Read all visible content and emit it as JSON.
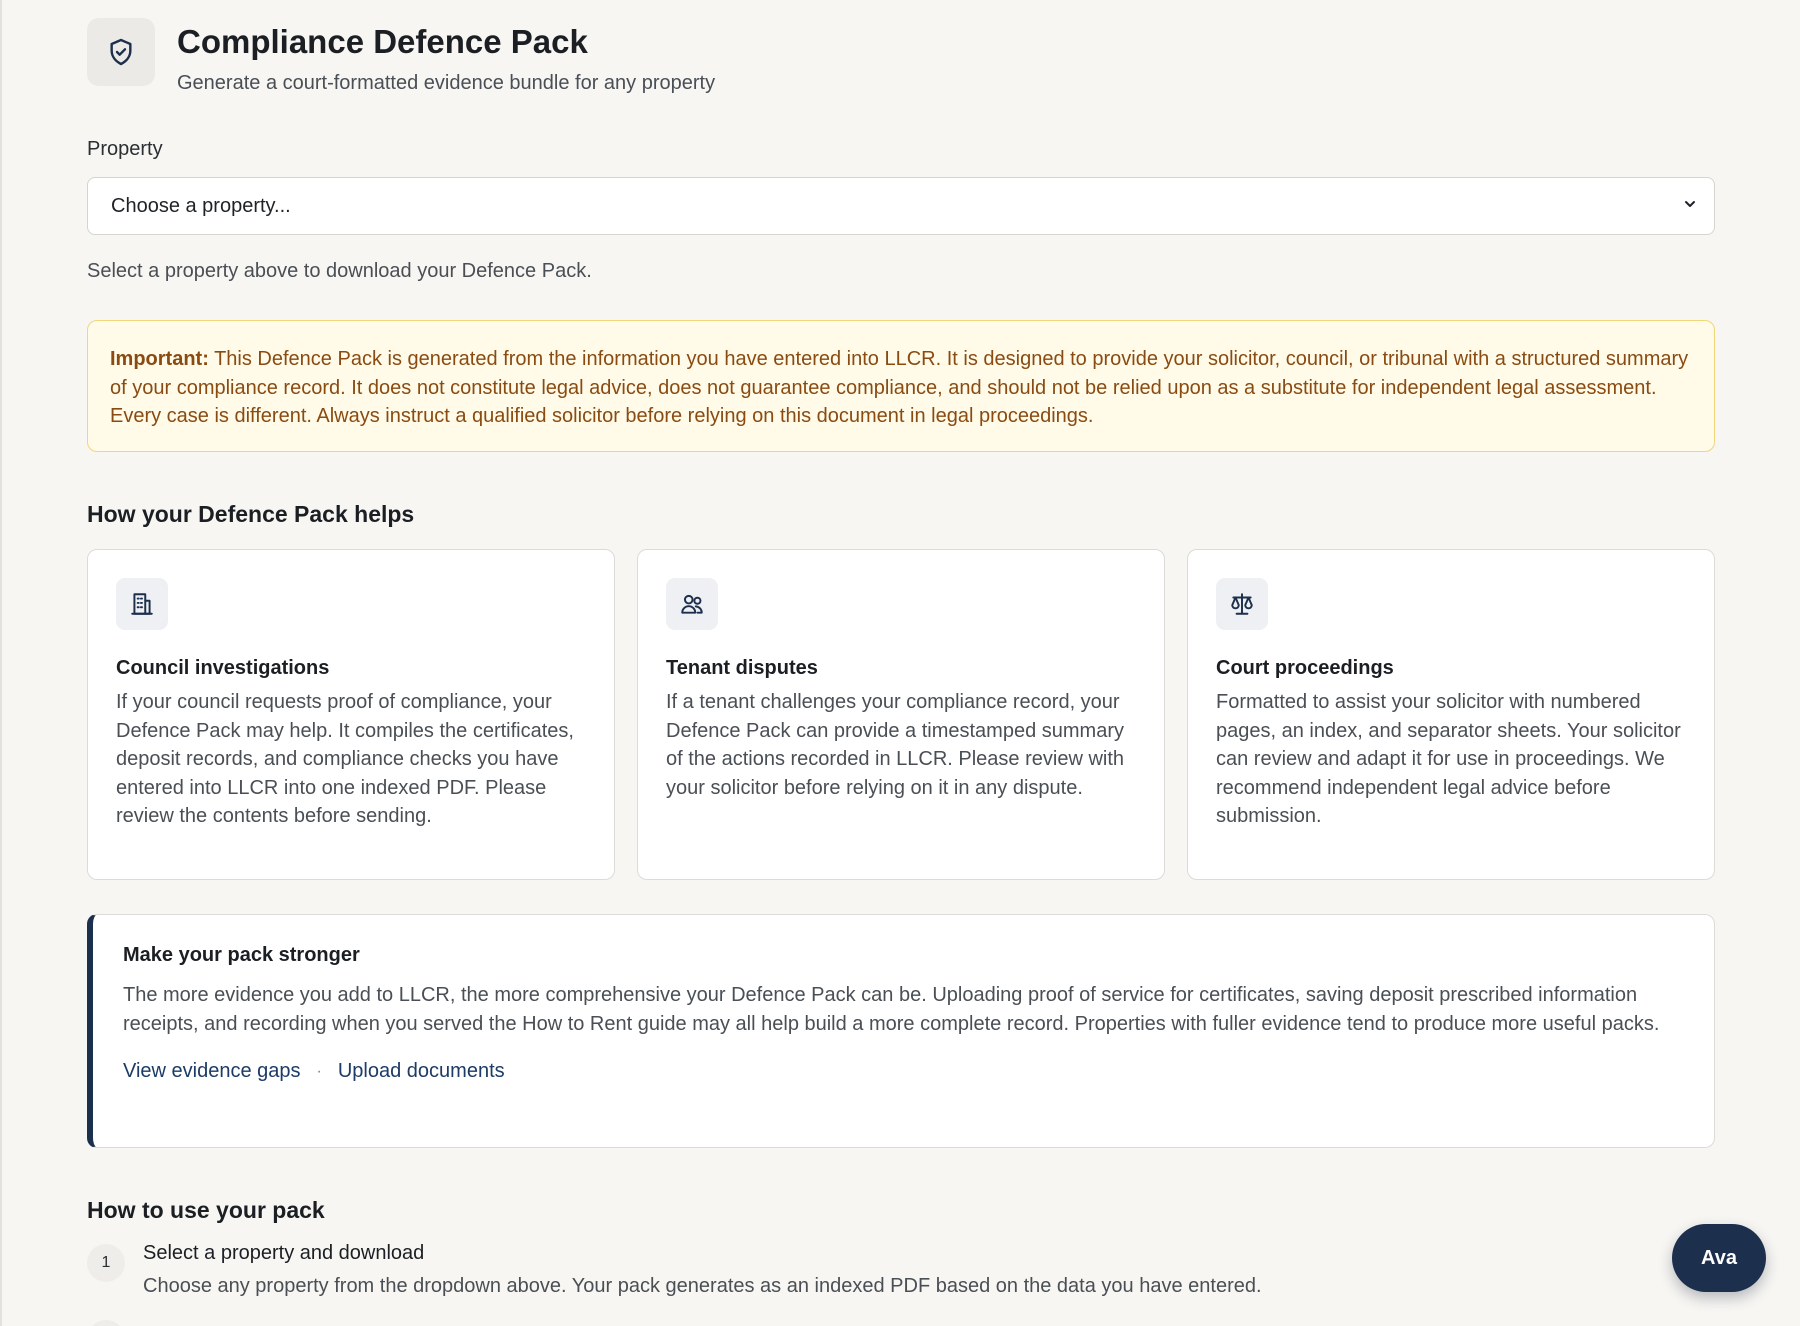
{
  "header": {
    "icon": "shield-check-icon",
    "title": "Compliance Defence Pack",
    "subtitle": "Generate a court-formatted evidence bundle for any property"
  },
  "property": {
    "label": "Property",
    "selected": "Choose a property...",
    "hint": "Select a property above to download your Defence Pack."
  },
  "alert": {
    "strong": "Important:",
    "text": "This Defence Pack is generated from the information you have entered into LLCR. It is designed to provide your solicitor, council, or tribunal with a structured summary of your compliance record. It does not constitute legal advice, does not guarantee compliance, and should not be relied upon as a substitute for independent legal assessment. Every case is different. Always instruct a qualified solicitor before relying on this document in legal proceedings."
  },
  "helps": {
    "title": "How your Defence Pack helps",
    "cards": [
      {
        "icon": "building-icon",
        "title": "Council investigations",
        "body": "If your council requests proof of compliance, your Defence Pack may help. It compiles the certificates, deposit records, and compliance checks you have entered into LLCR into one indexed PDF. Please review the contents before sending."
      },
      {
        "icon": "users-icon",
        "title": "Tenant disputes",
        "body": "If a tenant challenges your compliance record, your Defence Pack can provide a timestamped summary of the actions recorded in LLCR. Please review with your solicitor before relying on it in any dispute."
      },
      {
        "icon": "scales-icon",
        "title": "Court proceedings",
        "body": "Formatted to assist your solicitor with numbered pages, an index, and separator sheets. Your solicitor can review and adapt it for use in proceedings. We recommend independent legal advice before submission."
      }
    ]
  },
  "stronger": {
    "title": "Make your pack stronger",
    "body": "The more evidence you add to LLCR, the more comprehensive your Defence Pack can be. Uploading proof of service for certificates, saving deposit prescribed information receipts, and recording when you served the How to Rent guide may all help build a more complete record. Properties with fuller evidence tend to produce more useful packs.",
    "link_gaps": "View evidence gaps",
    "separator": "·",
    "link_upload": "Upload documents"
  },
  "usage": {
    "title": "How to use your pack",
    "steps": [
      {
        "num": "1",
        "title": "Select a property and download",
        "body": "Choose any property from the dropdown above. Your pack generates as an indexed PDF based on the data you have entered."
      }
    ]
  },
  "assistant": {
    "label": "Ava"
  },
  "colors": {
    "accent": "#1c2f4c",
    "alert_bg": "#fffbe8",
    "alert_text": "#8a4b12",
    "link": "#1c3b66"
  }
}
